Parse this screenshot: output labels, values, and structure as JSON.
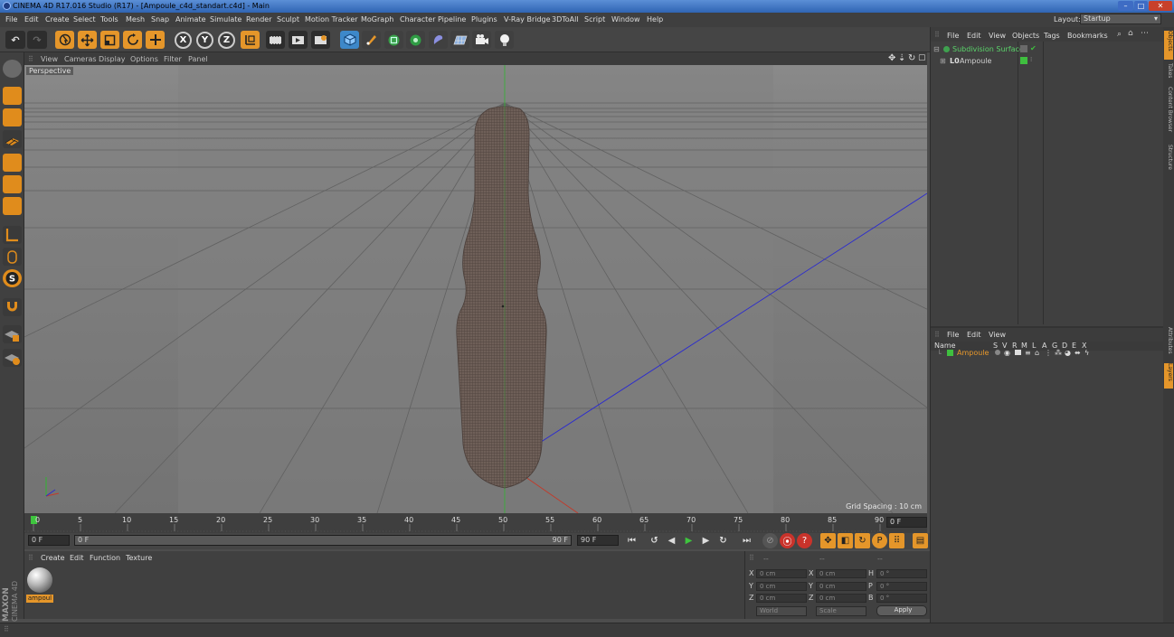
{
  "window": {
    "title": "CINEMA 4D R17.016 Studio (R17) - [Ampoule_c4d_standart.c4d] - Main",
    "controls": [
      "–",
      "□",
      "✕"
    ]
  },
  "menu": {
    "items": [
      "File",
      "Edit",
      "Create",
      "Select",
      "Tools",
      "Mesh",
      "Snap",
      "Animate",
      "Simulate",
      "Render",
      "Sculpt",
      "Motion Tracker",
      "MoGraph",
      "Character",
      "Pipeline",
      "Plugins",
      "V-Ray Bridge",
      "3DToAll",
      "Script",
      "Window",
      "Help"
    ],
    "layout_label": "Layout:",
    "layout_value": "Startup"
  },
  "toolbar": {
    "axis_x": "X",
    "axis_y": "Y",
    "axis_z": "Z",
    "icons": [
      "undo-icon",
      "redo-icon",
      "live-selection-icon",
      "move-icon",
      "scale-icon",
      "rotate-icon",
      "create-icon",
      "x-axis-icon",
      "y-axis-icon",
      "z-axis-icon",
      "coordinate-system-icon",
      "render-view-icon",
      "render-picture-viewer-icon",
      "render-settings-icon",
      "cube-icon",
      "pen-icon",
      "subdivision-icon",
      "array-icon",
      "deformer-icon",
      "floor-icon",
      "camera-icon",
      "light-icon"
    ]
  },
  "viewport": {
    "menu": [
      "View",
      "Cameras",
      "Display",
      "Options",
      "Filter",
      "Panel"
    ],
    "label": "Perspective",
    "grid_spacing": "Grid Spacing : 10 cm"
  },
  "timeline": {
    "ticks": [
      "0",
      "5",
      "10",
      "15",
      "20",
      "25",
      "30",
      "35",
      "40",
      "45",
      "50",
      "55",
      "60",
      "65",
      "70",
      "75",
      "80",
      "85",
      "90"
    ],
    "end_frame": "0 F",
    "current_frame": "0 F",
    "range_start": "0 F",
    "range_end": "90 F",
    "max_frame": "90 F"
  },
  "materials": {
    "menu": [
      "Create",
      "Edit",
      "Function",
      "Texture"
    ],
    "items": [
      {
        "name": "ampoul"
      }
    ]
  },
  "coordinates": {
    "header": [
      "--",
      "--",
      "--"
    ],
    "rows": [
      {
        "a": "X",
        "av": "0 cm",
        "b": "X",
        "bv": "0 cm",
        "c": "H",
        "cv": "0 °"
      },
      {
        "a": "Y",
        "av": "0 cm",
        "b": "Y",
        "bv": "0 cm",
        "c": "P",
        "cv": "0 °"
      },
      {
        "a": "Z",
        "av": "0 cm",
        "b": "Z",
        "bv": "0 cm",
        "c": "B",
        "cv": "0 °"
      }
    ],
    "world": "World",
    "scale": "Scale",
    "apply": "Apply"
  },
  "object_manager": {
    "menu": [
      "File",
      "Edit",
      "View",
      "Objects",
      "Tags",
      "Bookmarks"
    ],
    "objects": [
      {
        "name": "Subdivision Surface",
        "color": "#5ad46a"
      },
      {
        "name": "Ampoule",
        "color": "#cfcfcf"
      }
    ]
  },
  "layer_manager": {
    "menu": [
      "File",
      "Edit",
      "View"
    ],
    "columns": [
      "Name",
      "S",
      "V",
      "R",
      "M",
      "L",
      "A",
      "G",
      "D",
      "E",
      "X"
    ],
    "layers": [
      {
        "name": "Ampoule",
        "color": "#3fbf3f"
      }
    ]
  },
  "right_tabs": [
    "Objects",
    "Takes",
    "Content Browser",
    "Structure",
    "Attributes",
    "Layers"
  ],
  "branding": {
    "maxon": "MAXON",
    "cinema": "CINEMA 4D"
  },
  "colors": {
    "accent": "#e5962a",
    "viewport_bg": "#7b7b7b",
    "layer_green": "#3fbf3f"
  }
}
